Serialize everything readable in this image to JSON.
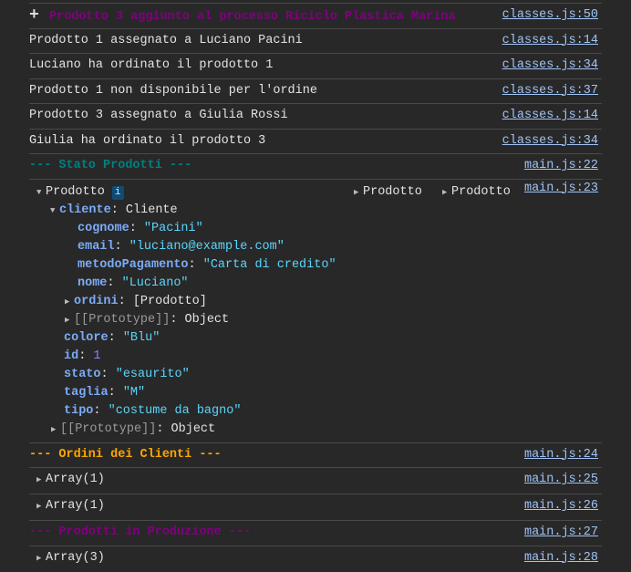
{
  "messages": [
    {
      "text": "Prodotto 3 aggiunto al processo Riciclo Plastica Marina",
      "source": "classes.js:50",
      "icon": "plus-icon"
    },
    {
      "text": "Prodotto 1 assegnato a Luciano Pacini",
      "source": "classes.js:14"
    },
    {
      "text": "Luciano ha ordinato il prodotto 1",
      "source": "classes.js:34"
    },
    {
      "text": "Prodotto 1 non disponibile per l'ordine",
      "source": "classes.js:37"
    },
    {
      "text": "Prodotto 3 assegnato a Giulia Rossi",
      "source": "classes.js:14"
    },
    {
      "text": "Giulia ha ordinato il prodotto 3",
      "source": "classes.js:34"
    },
    {
      "text": "--- Stato Prodotti ---",
      "source": "main.js:22"
    }
  ],
  "object": {
    "source": "main.js:23",
    "label": "Prodotto",
    "info": "i",
    "collapsed": [
      "Prodotto",
      "Prodotto"
    ],
    "cliente_key": "cliente",
    "cliente_type": "Cliente",
    "cognome_key": "cognome",
    "cognome": "\"Pacini\"",
    "email_key": "email",
    "email": "\"luciano@example.com\"",
    "metodo_key": "metodoPagamento",
    "metodo": "\"Carta di credito\"",
    "nome_key": "nome",
    "nome": "\"Luciano\"",
    "ordini_key": "ordini",
    "ordini": "[Prodotto]",
    "proto_key": "[[Prototype]]",
    "proto": "Object",
    "colore_key": "colore",
    "colore": "\"Blu\"",
    "id_key": "id",
    "id": "1",
    "stato_key": "stato",
    "stato": "\"esaurito\"",
    "taglia_key": "taglia",
    "taglia": "\"M\"",
    "tipo_key": "tipo",
    "tipo": "\"costume da bagno\""
  },
  "after": [
    {
      "text": "--- Ordini dei Clienti ---",
      "source": "main.js:24"
    },
    {
      "text": "Array(1)",
      "source": "main.js:25"
    },
    {
      "text": "Array(1)",
      "source": "main.js:26"
    },
    {
      "text": "--- Prodotti in Produzione ---",
      "source": "main.js:27"
    },
    {
      "text": "Array(3)",
      "source": "main.js:28"
    }
  ],
  "colors": {
    "purple": "#800080",
    "teal": "#008080",
    "orange": "#ffa500"
  }
}
